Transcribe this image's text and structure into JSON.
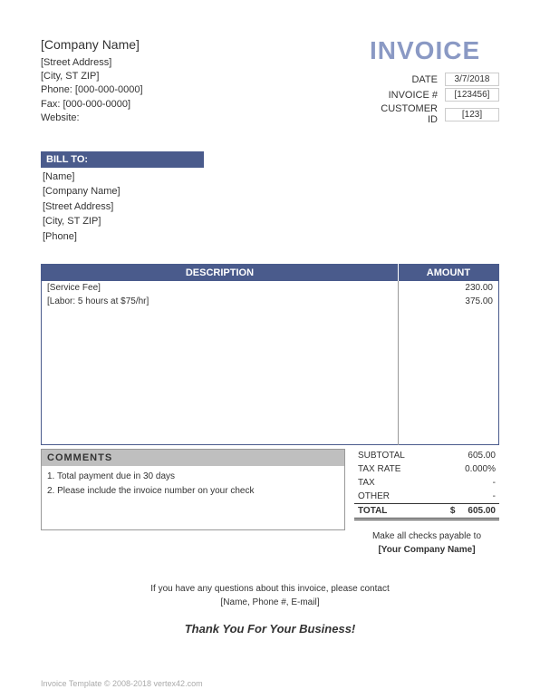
{
  "company": {
    "name": "[Company Name]",
    "street": "[Street Address]",
    "city_st_zip": "[City, ST  ZIP]",
    "phone": "Phone: [000-000-0000]",
    "fax": "Fax: [000-000-0000]",
    "website": "Website:"
  },
  "invoice_title": "INVOICE",
  "meta": {
    "date_label": "DATE",
    "date_value": "3/7/2018",
    "invoice_num_label": "INVOICE #",
    "invoice_num_value": "[123456]",
    "customer_id_label": "CUSTOMER ID",
    "customer_id_value": "[123]"
  },
  "bill_to": {
    "header": "BILL TO:",
    "name": "[Name]",
    "company": "[Company Name]",
    "street": "[Street Address]",
    "city_st_zip": "[City, ST  ZIP]",
    "phone": "[Phone]"
  },
  "table": {
    "desc_header": "DESCRIPTION",
    "amount_header": "AMOUNT",
    "rows": [
      {
        "desc": "[Service Fee]",
        "amount": "230.00"
      },
      {
        "desc": "[Labor: 5 hours at $75/hr]",
        "amount": "375.00"
      }
    ]
  },
  "comments": {
    "header": "COMMENTS",
    "line1": "1. Total payment due in 30 days",
    "line2": "2. Please include the invoice number on your check"
  },
  "totals": {
    "subtotal_label": "SUBTOTAL",
    "subtotal_value": "605.00",
    "taxrate_label": "TAX RATE",
    "taxrate_value": "0.000%",
    "tax_label": "TAX",
    "tax_value": "-",
    "other_label": "OTHER",
    "other_value": "-",
    "total_label": "TOTAL",
    "total_currency": "$",
    "total_value": "605.00"
  },
  "payable": {
    "line1": "Make all checks payable to",
    "line2": "[Your Company Name]"
  },
  "contact": {
    "line1": "If you have any questions about this invoice, please contact",
    "line2": "[Name, Phone #, E-mail]"
  },
  "thank_you": "Thank You For Your Business!",
  "footer": "Invoice Template © 2008-2018 vertex42.com"
}
